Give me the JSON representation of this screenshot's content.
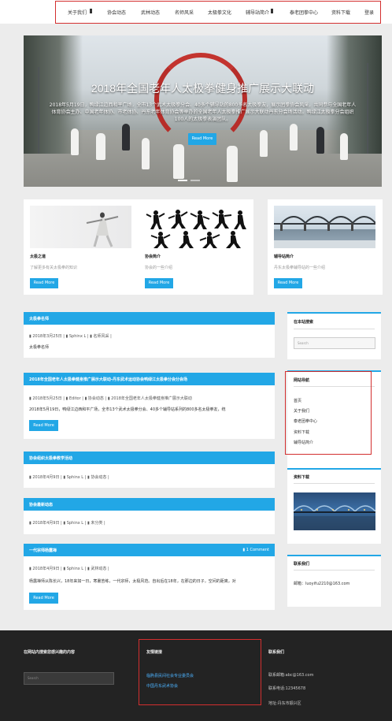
{
  "nav": {
    "items": [
      "关于我们",
      "协会动态",
      "武林动态",
      "名师风采",
      "太极拳文化",
      "辅导站简介",
      "泰老团拳中心",
      "资料下载",
      "登录"
    ]
  },
  "hero": {
    "title": "2018年全国老年人太极拳健身推广展示大联动",
    "description": "2018年5月19日，鸭绿江边西和平广场，全市13个武术太极拳分会、40多个辅导站的800多名太极拳友，展示团拳协会风采，共同参与全国老年人体育协会主办、中国老年体协、市老体协、丹东老年体育协会等举办的全国老年人太极拳推广展示大联动丹东分会场活动。鸭绿江太极拳分会组织100人的太极拳表演团队。",
    "button": "Read More"
  },
  "cards": [
    {
      "title": "太极之道",
      "desc": "了解更多有关太极拳的知识",
      "button": "Read More"
    },
    {
      "title": "协会简介",
      "desc": "协会的一些介绍",
      "button": "Read More"
    },
    {
      "title": "辅导站简介",
      "desc": "丹东太极拳辅导站的一些介绍",
      "button": "Read More"
    }
  ],
  "posts": [
    {
      "title": "太极拳名师",
      "meta": [
        "2018年3月25日",
        "Sphinx L",
        "名师风采"
      ],
      "excerpt": "太极拳名师"
    },
    {
      "title": "2018年全国老年人太极拳健身推广展示大联动-丹东武术运动协会鸭绿江太极拳分会分会场",
      "meta": [
        "2018年5月25日",
        "Editor",
        "协会动态",
        "2018年全国老年人太极拳健身推广展示大联动"
      ],
      "excerpt": "2018年5月19日，鸭绿江边西和平广场，全市13个武术太极拳分会、40多个辅导站系列的800多名太极拳友，统",
      "button": "Read More"
    },
    {
      "title": "协会组织太极拳教学活动",
      "meta": [
        "2018年4月9日",
        "Sphinx L",
        "协会动态"
      ]
    },
    {
      "title": "协会最新动态",
      "meta": [
        "2018年4月9日",
        "Sphinx L",
        "未分类"
      ]
    },
    {
      "title": "一代宗师杨露禅",
      "comment": "1 Comment",
      "meta": [
        "2018年4月9日",
        "Sphinx L",
        "武林动态"
      ],
      "excerpt": "杨露禅师从陈长兴，18年来如一日，寒暑苦练，一代宗师，太极风范。自出后在18年，在那边的日子，空间的距离，对",
      "button": "Read More"
    }
  ],
  "sidebar": {
    "search_title": "在本站搜索",
    "search_placeholder": "Search",
    "nav_title": "网站导航",
    "nav_links": [
      "首页",
      "关于我们",
      "泰老团拳中心",
      "资料下载",
      "辅导站简介"
    ],
    "download_title": "资料下载",
    "contact_title": "联系我们",
    "contact_email": "邮箱：luoyifu2210@163.com"
  },
  "footer": {
    "search_title": "在网站内搜索您感兴趣的内容",
    "search_placeholder": "Search",
    "links_title": "友情链接",
    "links": [
      "临朐县民间社会专业委员会",
      "中国丹东武术协会"
    ],
    "contact_title": "联系我们",
    "contact": [
      "联系邮箱:abc@163.com",
      "联系电话:12345678",
      "地址:丹东市振兴区"
    ]
  },
  "colors": {
    "accent": "#22a7e6",
    "highlight": "#d32f2f",
    "footer_bg": "#232323"
  }
}
